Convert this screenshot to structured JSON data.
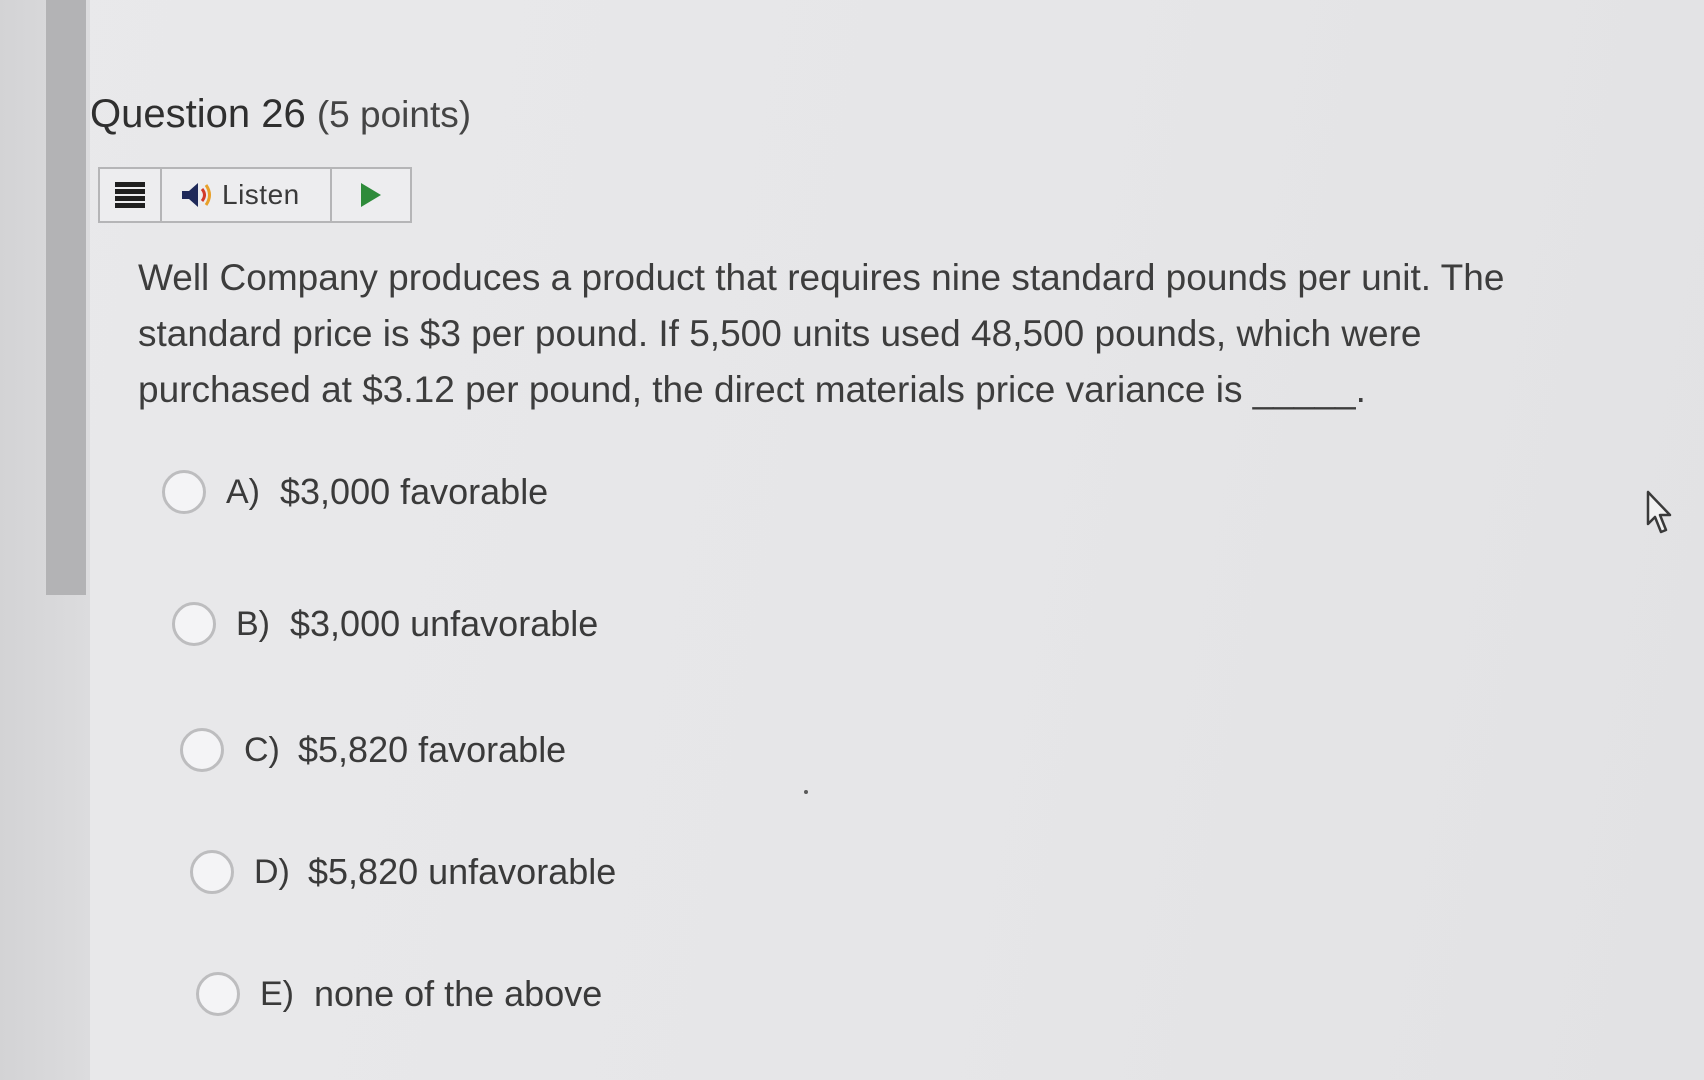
{
  "question": {
    "title": "Question 26",
    "points": "(5 points)",
    "text": "Well Company produces a product that requires nine standard pounds per unit. The standard price is $3 per pound. If 5,500 units used 48,500 pounds, which were purchased at $3.12 per pound, the direct materials price variance is _____."
  },
  "toolbar": {
    "menu_icon": "hamburger-menu-icon",
    "speaker_icon": "speaker-icon",
    "listen_label": "Listen",
    "play_icon": "play-icon",
    "play_color": "#2e8b3a"
  },
  "choices": [
    {
      "letter": "A)",
      "text": "$3,000 favorable"
    },
    {
      "letter": "B)",
      "text": "$3,000 unfavorable"
    },
    {
      "letter": "C)",
      "text": "$5,820 favorable"
    },
    {
      "letter": "D)",
      "text": "$5,820 unfavorable"
    },
    {
      "letter": "E)",
      "text": "none of the above"
    }
  ]
}
